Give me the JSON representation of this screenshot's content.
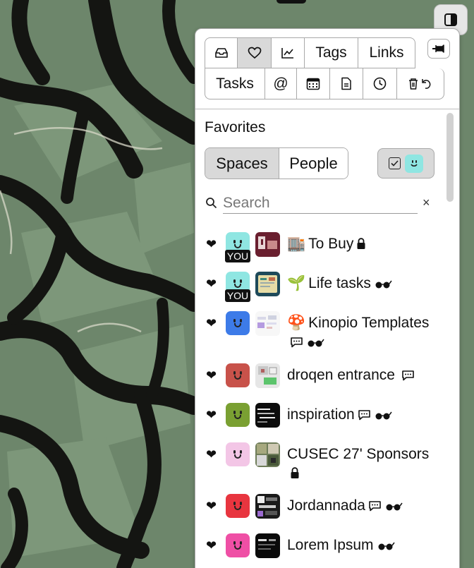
{
  "top_button": {
    "icon": "split-panel-icon"
  },
  "pin_button": {
    "icon": "pin-icon"
  },
  "tabs": {
    "row1": [
      {
        "id": "inbox",
        "icon": "inbox-icon"
      },
      {
        "id": "favorites",
        "icon": "heart-icon",
        "active": true
      },
      {
        "id": "stats",
        "icon": "chart-icon"
      },
      {
        "id": "tags",
        "label": "Tags"
      },
      {
        "id": "links",
        "label": "Links"
      }
    ],
    "row2": [
      {
        "id": "tasks",
        "label": "Tasks"
      },
      {
        "id": "mentions",
        "label": "@"
      },
      {
        "id": "calendar",
        "icon": "calendar-icon"
      },
      {
        "id": "document",
        "icon": "document-icon"
      },
      {
        "id": "history",
        "icon": "clock-icon"
      },
      {
        "id": "trash",
        "icon": "trash-restore-icon"
      }
    ]
  },
  "section_title": "Favorites",
  "segmented": {
    "spaces": "Spaces",
    "people": "People",
    "selected": "Spaces"
  },
  "filter": {
    "icons": [
      "checkbox-icon",
      "user-face-icon"
    ]
  },
  "search": {
    "placeholder": "Search",
    "value": "",
    "clear": "×"
  },
  "favorites": [
    {
      "emoji": "🏬",
      "name": "To Buy",
      "badges": [
        "lock"
      ],
      "user_color": "#8fe6e2",
      "you": true,
      "thumb": "maroon"
    },
    {
      "emoji": "🌱",
      "name": "Life tasks",
      "badges": [
        "glasses"
      ],
      "user_color": "#8fe6e2",
      "you": true,
      "thumb": "teal-doc"
    },
    {
      "emoji": "🍄",
      "name": "Kinopio Templates",
      "badges": [
        "comment",
        "glasses"
      ],
      "user_color": "#3d7be8",
      "you": false,
      "thumb": "light-cards"
    },
    {
      "emoji": "",
      "name": "droqen entrance",
      "badges": [
        "comment"
      ],
      "user_color": "#c8524a",
      "you": false,
      "thumb": "grey-green"
    },
    {
      "emoji": "",
      "name": "inspiration",
      "badges": [
        "comment",
        "glasses"
      ],
      "user_color": "#7aa032",
      "you": false,
      "thumb": "dark-lines"
    },
    {
      "emoji": "",
      "name": "CUSEC 27' Sponsors",
      "badges": [
        "lock"
      ],
      "user_color": "#f3c6e6",
      "you": false,
      "thumb": "photo-grid"
    },
    {
      "emoji": "",
      "name": "Jordannada",
      "badges": [
        "comment",
        "glasses"
      ],
      "user_color": "#e8353f",
      "you": false,
      "thumb": "dark-mosaic"
    },
    {
      "emoji": "",
      "name": "Lorem Ipsum",
      "badges": [
        "glasses"
      ],
      "user_color": "#ef4fa5",
      "you": false,
      "thumb": "black-text"
    }
  ],
  "you_label": "YOU"
}
